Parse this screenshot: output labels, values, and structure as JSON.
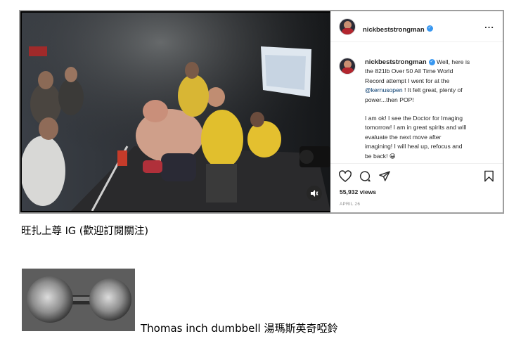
{
  "post": {
    "username": "nickbeststrongman",
    "more_icon": "...",
    "caption_lines": [
      "Well, here is",
      "the 821lb Over 50 All Time World",
      "Record attempt I went for at the",
      "@kernusopen ! It felt great, plenty of",
      "power...then POP!"
    ],
    "caption_mention": "@kernusopen",
    "caption2_lines": [
      "I am ok! I see the Doctor for Imaging",
      "tomorrow! I am in great spirits and will",
      "evaluate the next move after",
      "imagining! I will heal up, refocus and",
      "be back! 😀"
    ],
    "views": "55,932 views",
    "date": "APRIL 26",
    "icons": [
      "heart-icon",
      "comment-icon",
      "share-icon",
      "bookmark-icon",
      "mute-icon",
      "verified-badge-icon"
    ]
  },
  "captions": {
    "ig_caption": "旺扎上尊 IG (歡迎訂閱關注)",
    "dumbbell_caption": "Thomas inch dumbbell  湯瑪斯英奇啞鈴"
  },
  "colors": {
    "accent_blue": "#3897f0",
    "border": "#9e9e9e",
    "text": "#262626",
    "muted": "#8e8e8e",
    "mention": "#00376b"
  }
}
